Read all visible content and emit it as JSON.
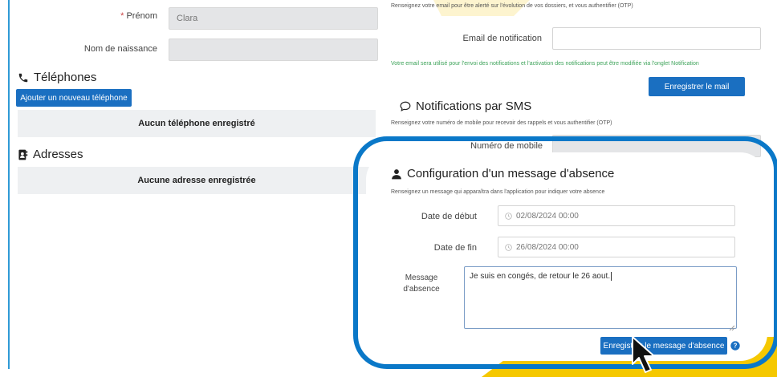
{
  "identity": {
    "prenom_label": "Prénom",
    "prenom_required_mark": "*",
    "prenom_value": "Clara",
    "nom_naissance_label": "Nom de naissance",
    "nom_naissance_value": ""
  },
  "telephones": {
    "title": "Téléphones",
    "add_button": "Ajouter un nouveau téléphone",
    "empty_text": "Aucun téléphone enregistré"
  },
  "adresses": {
    "title": "Adresses",
    "empty_text": "Aucune adresse enregistrée"
  },
  "email_notification": {
    "help": "Renseignez votre email pour être alerté sur l'évolution de vos dossiers, et vous authentifier (OTP)",
    "label": "Email de notification",
    "value": "",
    "note": "Votre email sera utilisé pour l'envoi des notifications et l'activation des notifications peut être modifiée via l'onglet Notification",
    "save_button": "Enregistrer le mail"
  },
  "sms": {
    "title": "Notifications par SMS",
    "help": "Renseignez votre numéro de mobile pour recevoir des rappels et vous authentifier (OTP)",
    "mobile_label": "Numéro de mobile",
    "mobile_value": ""
  },
  "absence": {
    "title": "Configuration d'un message d'absence",
    "help": "Renseignez un message qui apparaîtra dans l'application pour indiquer votre absence",
    "date_debut_label": "Date de début",
    "date_debut_value": "02/08/2024 00:00",
    "date_fin_label": "Date de fin",
    "date_fin_value": "26/08/2024 00:00",
    "message_label_line1": "Message",
    "message_label_line2": "d'absence",
    "message_value": "Je suis en congés, de retour le 26 aout.",
    "save_button": "Enregistrer le message d'absence"
  },
  "colors": {
    "primary_button": "#1a6fc1",
    "highlight": "#0a78c8",
    "accent_yellow": "#f5c800",
    "note_green": "#3ea35a"
  },
  "icons": {
    "phone": "phone-icon",
    "address": "address-book-icon",
    "sms": "chat-bubble-icon",
    "absence": "user-icon",
    "date": "clock-icon",
    "help": "question-circle-icon",
    "cursor": "mouse-pointer-icon"
  }
}
